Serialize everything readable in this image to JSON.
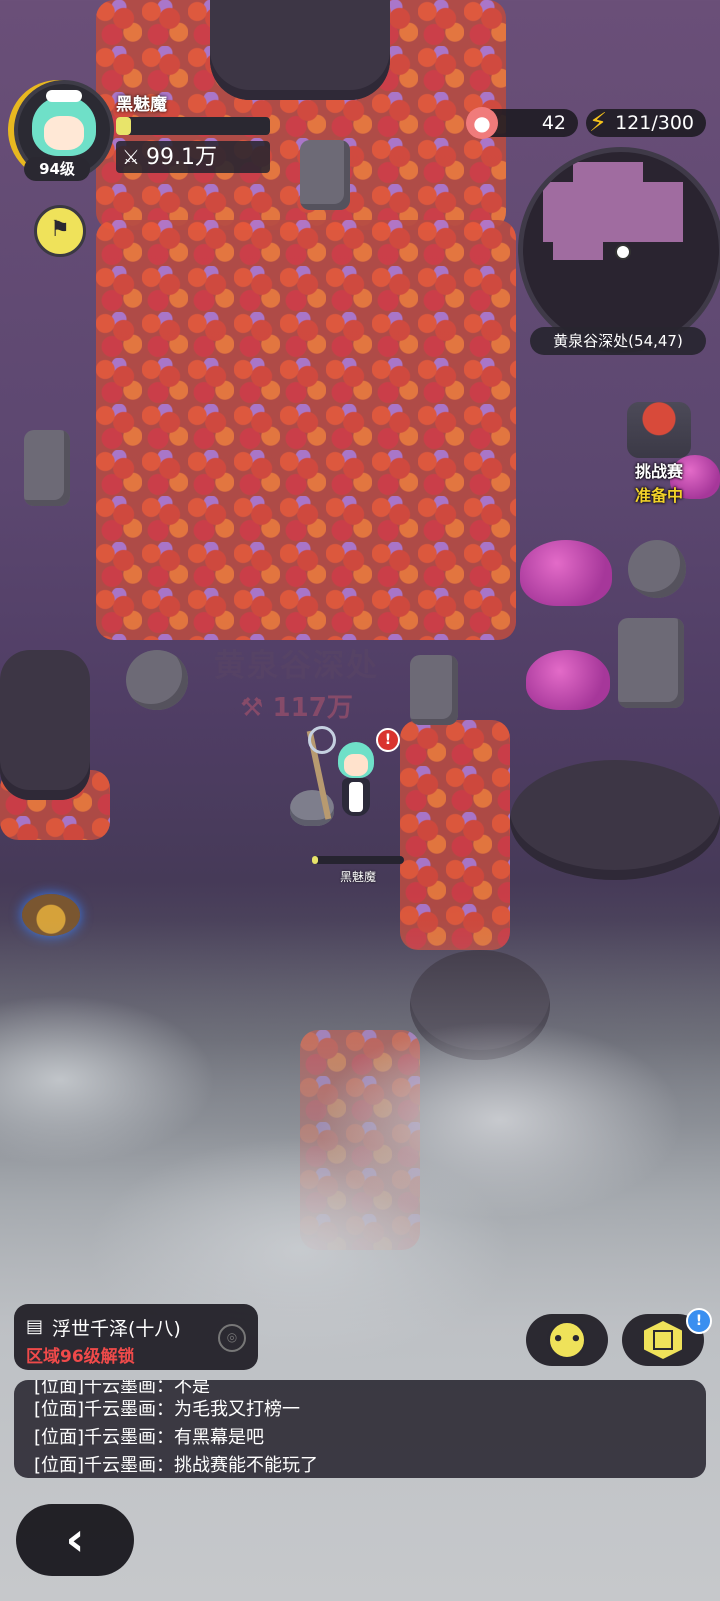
{
  "player": {
    "name": "黑魅魔",
    "level": "94级",
    "power": "99.1万",
    "hp_fraction": 0.1
  },
  "resources": {
    "peach": {
      "icon": "peach-icon",
      "value": "42"
    },
    "energy": {
      "icon": "lightning-icon",
      "value": "121/300"
    }
  },
  "minimap": {
    "location_label": "黄泉谷深处(54,47)"
  },
  "zone_watermark": {
    "name": "黄泉谷深处",
    "power": "117万"
  },
  "character": {
    "name": "黑魅魔",
    "alert": "!"
  },
  "event": {
    "title": "挑战赛",
    "status": "准备中"
  },
  "next_zone": {
    "title": "浮世千泽(十八)",
    "unlock_text": "区域96级解锁"
  },
  "chat": {
    "lines": [
      "[位面]千云墨画：不是",
      "[位面]千云墨画：为毛我又打榜一",
      "[位面]千云墨画：有黑幕是吧",
      "[位面]千云墨画：挑战赛能不能玩了"
    ]
  },
  "buttons": {
    "emoji": "emoji-icon",
    "box": "cube-box-icon",
    "box_badge": "!",
    "back": "back-arrow-icon",
    "flag": "flag-icon"
  },
  "colors": {
    "accent_yellow": "#efe25a",
    "alert_red": "#d9342f",
    "unlock_red": "#ef4a4a",
    "event_yellow": "#f1d12a"
  }
}
